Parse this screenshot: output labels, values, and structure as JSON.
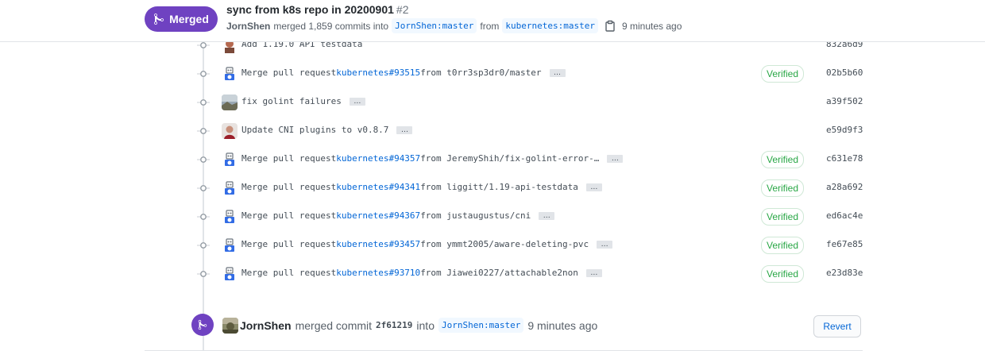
{
  "header": {
    "state": "Merged",
    "title": "sync from k8s repo in 20200901",
    "number": "#2",
    "author": "JornShen",
    "merged_text": "merged 1,859 commits into",
    "base_branch": "JornShen:master",
    "from_text": "from",
    "head_branch": "kubernetes:master",
    "time": "9 minutes ago"
  },
  "commits": [
    {
      "pre": "Add 1.19.0 API testdata",
      "link": "",
      "post": "",
      "ellipsis": false,
      "verified": "",
      "sha": "832a6d9",
      "avatar": "person-dark"
    },
    {
      "pre": "Merge pull request ",
      "link": "kubernetes#93515",
      "post": " from t0rr3sp3dr0/master",
      "ellipsis": true,
      "verified": "Verified",
      "sha": "02b5b60",
      "avatar": "k8s-bot"
    },
    {
      "pre": "fix golint failures",
      "link": "",
      "post": "",
      "ellipsis": true,
      "verified": "",
      "sha": "a39f502",
      "avatar": "person-landscape"
    },
    {
      "pre": "Update CNI plugins to v0.8.7",
      "link": "",
      "post": "",
      "ellipsis": true,
      "verified": "",
      "sha": "e59d9f3",
      "avatar": "person-red"
    },
    {
      "pre": "Merge pull request ",
      "link": "kubernetes#94357",
      "post": " from JeremyShih/fix-golint-error-…",
      "ellipsis": true,
      "verified": "Verified",
      "sha": "c631e78",
      "avatar": "k8s-bot"
    },
    {
      "pre": "Merge pull request ",
      "link": "kubernetes#94341",
      "post": " from liggitt/1.19-api-testdata",
      "ellipsis": true,
      "verified": "Verified",
      "sha": "a28a692",
      "avatar": "k8s-bot"
    },
    {
      "pre": "Merge pull request ",
      "link": "kubernetes#94367",
      "post": " from justaugustus/cni",
      "ellipsis": true,
      "verified": "Verified",
      "sha": "ed6ac4e",
      "avatar": "k8s-bot"
    },
    {
      "pre": "Merge pull request ",
      "link": "kubernetes#93457",
      "post": " from ymmt2005/aware-deleting-pvc",
      "ellipsis": true,
      "verified": "Verified",
      "sha": "fe67e85",
      "avatar": "k8s-bot"
    },
    {
      "pre": "Merge pull request ",
      "link": "kubernetes#93710",
      "post": " from Jiawei0227/attachable2non",
      "ellipsis": true,
      "verified": "Verified",
      "sha": "e23d83e",
      "avatar": "k8s-bot"
    }
  ],
  "merge_event": {
    "author": "JornShen",
    "text": "merged commit",
    "sha": "2f61219",
    "into": "into",
    "branch": "JornShen:master",
    "time": "9 minutes ago",
    "revert_label": "Revert"
  },
  "colors": {
    "merged": "#6f42c1",
    "link": "#0366d6",
    "verified": "#28a745"
  }
}
